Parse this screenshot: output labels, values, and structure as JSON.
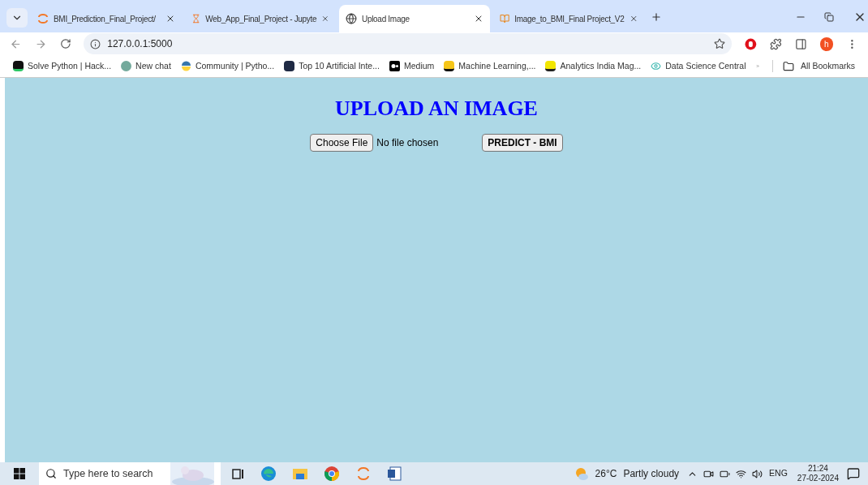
{
  "tabs": [
    {
      "title": "BMI_Prediction_Final_Project/",
      "selected": false,
      "kind": "jupyter"
    },
    {
      "title": "Web_App_Final_Project - Jupyte",
      "selected": false,
      "kind": "hourglass"
    },
    {
      "title": "Upload Image",
      "selected": true,
      "kind": "globe"
    },
    {
      "title": "Image_to_BMI_Final Project_V2",
      "selected": false,
      "kind": "notebook"
    }
  ],
  "address": "127.0.0.1:5000",
  "profile_initial": "h",
  "bookmarks": [
    {
      "label": "Solve Python | Hack...",
      "kind": "hackerrank"
    },
    {
      "label": "New chat",
      "kind": "chat"
    },
    {
      "label": "Community | Pytho...",
      "kind": "python"
    },
    {
      "label": "Top 10 Artificial Inte...",
      "kind": "letter-a"
    },
    {
      "label": "Medium",
      "kind": "medium"
    },
    {
      "label": "Machine Learning,...",
      "kind": "k"
    },
    {
      "label": "Analytics India Mag...",
      "kind": "analytics"
    },
    {
      "label": "Data Science Central",
      "kind": "eye"
    }
  ],
  "all_bookmarks": "All Bookmarks",
  "page": {
    "heading": "UPLOAD AN IMAGE",
    "file_button": "Choose File",
    "file_status": "No file chosen",
    "submit": "PREDICT - BMI"
  },
  "taskbar": {
    "search_placeholder": "Type here to search",
    "weather_temp": "26°C",
    "weather_text": "Partly cloudy",
    "language": "ENG",
    "time": "21:24",
    "date": "27-02-2024"
  }
}
